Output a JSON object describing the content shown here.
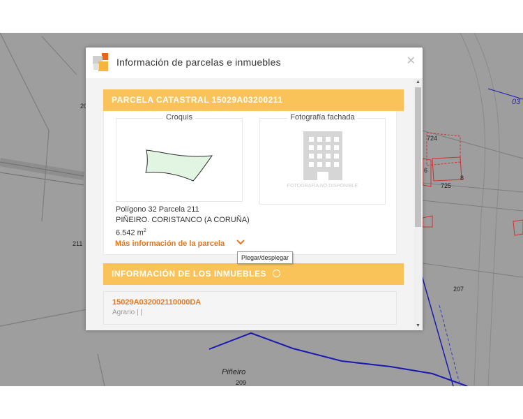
{
  "dialog": {
    "title": "Información de parcelas e inmuebles",
    "close_label": "✕"
  },
  "parcela": {
    "header": "PARCELA CATASTRAL 15029A03200211",
    "croquis_label": "Croquis",
    "fachada_label": "Fotografía fachada",
    "photo_unavailable": "FOTOGRAFÍA NO DISPONIBLE",
    "location_line1": "Polígono 32 Parcela 211",
    "location_line2": "PIÑEIRO. CORISTANCO (A CORUÑA)",
    "area_value": "6.542 m",
    "area_sup": "2",
    "more_info_link": "Más información de la parcela",
    "toggle_tooltip": "Plegar/desplegar"
  },
  "inmuebles": {
    "header": "INFORMACIÓN DE LOS INMUEBLES",
    "items": [
      {
        "reference": "15029A032002110000DA",
        "use": "Agrario | |"
      }
    ]
  },
  "map": {
    "labels": [
      "20",
      "211",
      "Piñeiro",
      "209",
      "207",
      "03",
      "724",
      "725",
      "6",
      "8"
    ]
  },
  "colors": {
    "section_header": "#f9c35a",
    "link": "#e0781f",
    "map_background": "#9e9e9e",
    "parcel_border_red": "#d03030",
    "boundary_blue": "#1a1ab0"
  }
}
